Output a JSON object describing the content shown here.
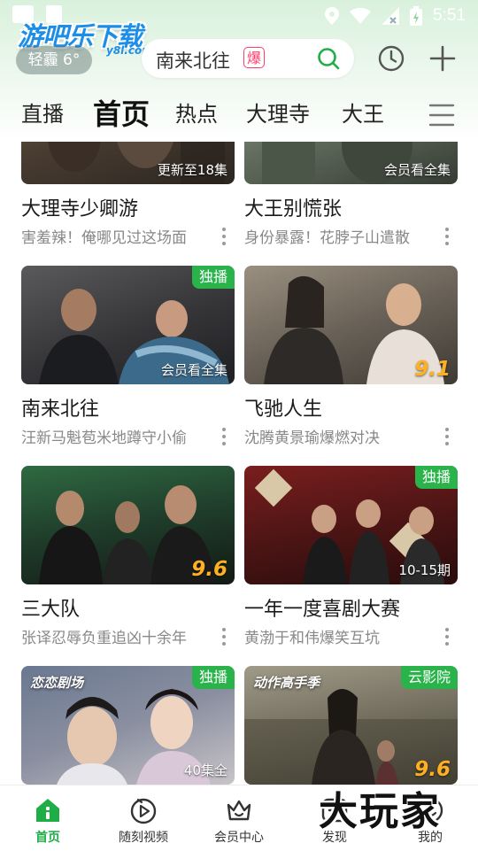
{
  "status_bar": {
    "time": "5:51"
  },
  "header": {
    "logo_text": "游吧乐下载",
    "logo_sub": "y8l.com",
    "weather": "轻霾 6°",
    "search": {
      "text": "南来北往",
      "badge": "爆"
    }
  },
  "nav_tabs": [
    "直播",
    "首页",
    "热点",
    "大理寺",
    "大王"
  ],
  "active_tab_index": 1,
  "feed": {
    "cards": [
      {
        "title": "大理寺少卿游",
        "subtitle": "害羞辣！俺哪见过这场面",
        "corner_tag": "",
        "bottom_tag": "更新至18集",
        "score": "",
        "brand": ""
      },
      {
        "title": "大王别慌张",
        "subtitle": "身份暴露！花脖子山遣散",
        "corner_tag": "",
        "bottom_tag": "会员看全集",
        "score": "",
        "brand": ""
      },
      {
        "title": "南来北往",
        "subtitle": "汪新马魁苞米地蹲守小偷",
        "corner_tag": "独播",
        "bottom_tag": "会员看全集",
        "score": "",
        "brand": ""
      },
      {
        "title": "飞驰人生",
        "subtitle": "沈腾黄景瑜爆燃对决",
        "corner_tag": "",
        "bottom_tag": "",
        "score": "9.1",
        "brand": ""
      },
      {
        "title": "三大队",
        "subtitle": "张译忍辱负重追凶十余年",
        "corner_tag": "",
        "bottom_tag": "",
        "score": "9.6",
        "brand": ""
      },
      {
        "title": "一年一度喜剧大赛",
        "subtitle": "黄渤于和伟爆笑互坑",
        "corner_tag": "独播",
        "bottom_tag": "10-15期",
        "score": "",
        "brand": ""
      },
      {
        "title": "",
        "subtitle": "",
        "corner_tag": "独播",
        "bottom_tag": "40集全",
        "score": "",
        "brand": "恋恋剧场"
      },
      {
        "title": "",
        "subtitle": "",
        "corner_tag": "云影院",
        "bottom_tag": "",
        "score": "9.6",
        "brand": "动作高手季"
      }
    ]
  },
  "bottom_nav": {
    "items": [
      {
        "label": "首页",
        "icon": "home-icon"
      },
      {
        "label": "随刻视频",
        "icon": "play-circle-icon"
      },
      {
        "label": "会员中心",
        "icon": "crown-icon"
      },
      {
        "label": "发现",
        "icon": "discover-icon"
      },
      {
        "label": "我的",
        "icon": "profile-icon"
      }
    ],
    "active_index": 0
  },
  "watermark": "大玩家",
  "colors": {
    "accent": "#1fae46",
    "tag_green": "#29b34a",
    "score": "#ffb020",
    "hot": "#ff3d6b"
  }
}
